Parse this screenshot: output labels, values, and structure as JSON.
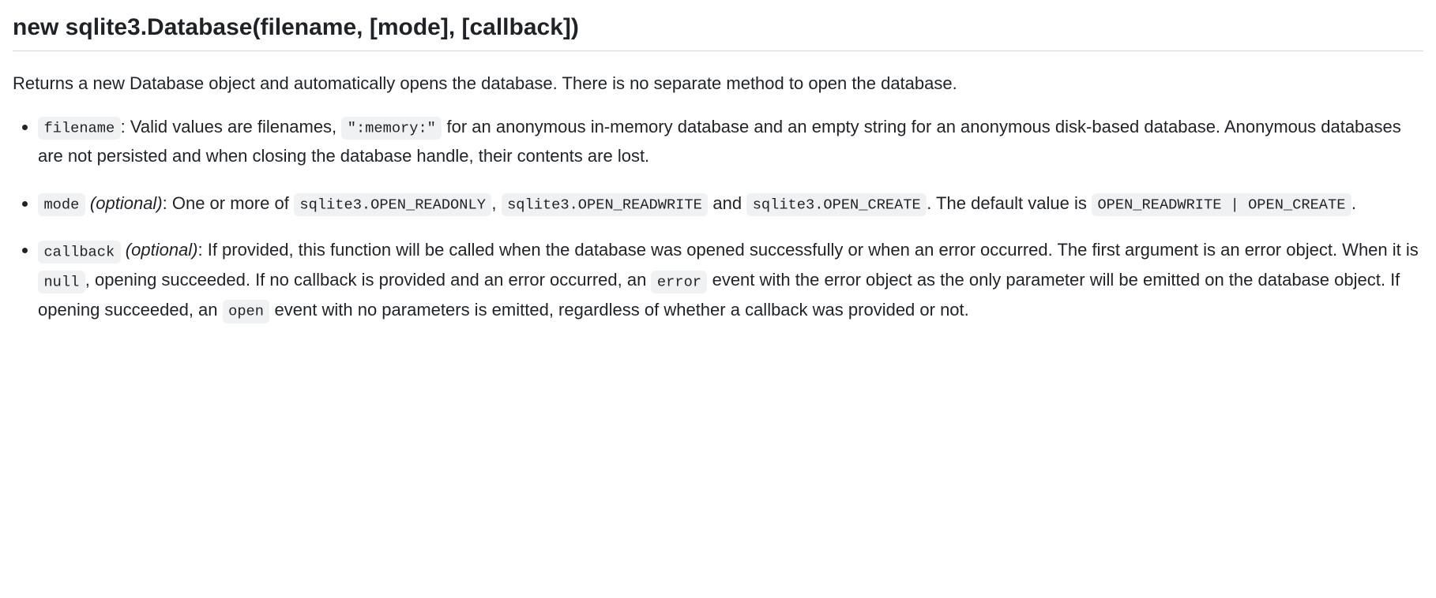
{
  "heading": "new sqlite3.Database(filename, [mode], [callback])",
  "intro": "Returns a new Database object and automatically opens the database. There is no separate method to open the database.",
  "params": {
    "filename": {
      "name": "filename",
      "text_before_memory": ": Valid values are filenames, ",
      "memory_code": "\":memory:\"",
      "text_after_memory": " for an anonymous in-memory database and an empty string for an anonymous disk-based database. Anonymous databases are not persisted and when closing the database handle, their contents are lost."
    },
    "mode": {
      "name": "mode",
      "optional_label": "(optional)",
      "text1": ": One or more of ",
      "code1": "sqlite3.OPEN_READONLY",
      "sep1": ", ",
      "code2": "sqlite3.OPEN_READWRITE",
      "sep2": " and ",
      "code3": "sqlite3.OPEN_CREATE",
      "text2": ". The default value is ",
      "code4": "OPEN_READWRITE | OPEN_CREATE",
      "text3": "."
    },
    "callback": {
      "name": "callback",
      "optional_label": "(optional)",
      "text1": ": If provided, this function will be called when the database was opened successfully or when an error occurred. The first argument is an error object. When it is ",
      "code1": "null",
      "text2": ", opening succeeded. If no callback is provided and an error occurred, an ",
      "code2": "error",
      "text3": " event with the error object as the only parameter will be emitted on the database object. If opening succeeded, an ",
      "code3": "open",
      "text4": " event with no parameters is emitted, regardless of whether a callback was provided or not."
    }
  }
}
